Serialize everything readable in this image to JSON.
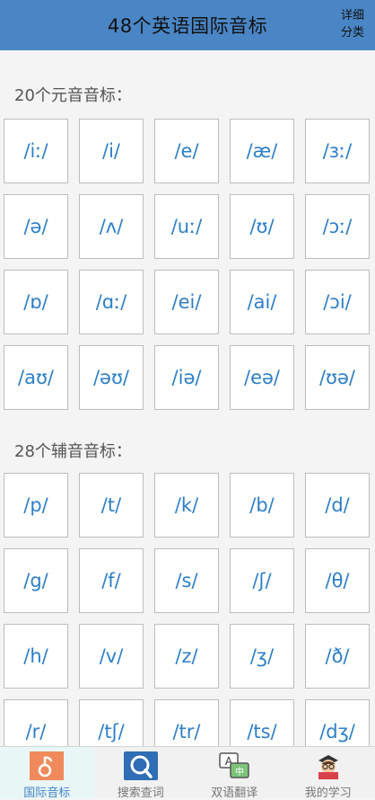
{
  "header": {
    "title": "48个英语国际音标",
    "detail_line1": "详细",
    "detail_line2": "分类"
  },
  "vowels": {
    "title": "20个元音音标：",
    "items": [
      "/iː/",
      "/i/",
      "/e/",
      "/æ/",
      "/ɜː/",
      "/ə/",
      "/ʌ/",
      "/uː/",
      "/ʊ/",
      "/ɔː/",
      "/ɒ/",
      "/ɑː/",
      "/ei/",
      "/ai/",
      "/ɔi/",
      "/aʊ/",
      "/əʊ/",
      "/iə/",
      "/eə/",
      "/ʊə/"
    ]
  },
  "consonants": {
    "title": "28个辅音音标：",
    "items": [
      "/p/",
      "/t/",
      "/k/",
      "/b/",
      "/d/",
      "/g/",
      "/f/",
      "/s/",
      "/ʃ/",
      "/θ/",
      "/h/",
      "/v/",
      "/z/",
      "/ʒ/",
      "/ð/",
      "/r/",
      "/tʃ/",
      "/tr/",
      "/ts/",
      "/dʒ/"
    ]
  },
  "tabbar": {
    "tabs": [
      {
        "label": "国际音标",
        "icon": "music-note-icon",
        "active": true
      },
      {
        "label": "搜索查词",
        "icon": "search-icon",
        "active": false
      },
      {
        "label": "双语翻译",
        "icon": "translate-icon",
        "active": false
      },
      {
        "label": "我的学习",
        "icon": "student-icon",
        "active": false
      }
    ]
  },
  "colors": {
    "header_bg": "#4a86c6",
    "phonetic_text": "#2d7fc8",
    "active_tab_bg": "#e8f6f6"
  }
}
